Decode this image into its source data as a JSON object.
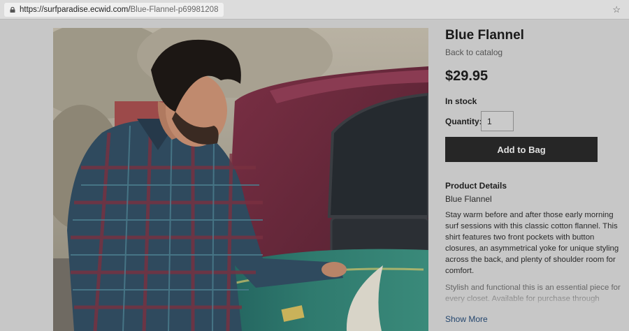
{
  "browser": {
    "url_protocol": "https://surfparadise.ecwid.com/",
    "url_path": "Blue-Flannel-p69981208"
  },
  "product": {
    "title": "Blue Flannel",
    "back_label": "Back to catalog",
    "price": "$29.95",
    "stock": "In stock",
    "quantity_label": "Quantity:",
    "quantity_value": "1",
    "add_button": "Add to Bag",
    "details_heading": "Product Details",
    "details_name": "Blue Flannel",
    "description": "Stay warm before and after those early morning surf sessions with this classic cotton flannel. This shirt features two front pockets with button closures, an asymmetrical yoke for unique styling across the back, and plenty of shoulder room for comfort.",
    "description_more": "Stylish and functional this is an essential piece for every closet. Available for purchase through",
    "show_more": "Show More"
  },
  "icons": {
    "lock": "lock-icon",
    "star": "star-icon"
  }
}
